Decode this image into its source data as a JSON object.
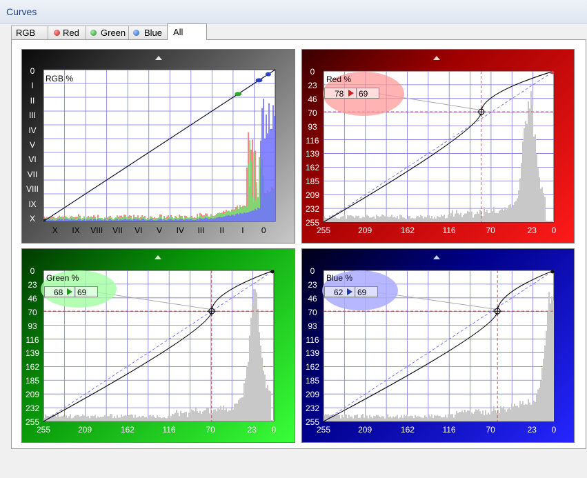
{
  "window": {
    "title": "Curves"
  },
  "tabs": [
    {
      "label": "RGB",
      "dot": ""
    },
    {
      "label": "Red",
      "dot": "#d03030"
    },
    {
      "label": "Green",
      "dot": "#30a030"
    },
    {
      "label": "Blue",
      "dot": "#2f6fd0"
    },
    {
      "label": "All",
      "dot": ""
    }
  ],
  "active_tab": "All",
  "panels": {
    "rgb": {
      "graph_label": "RGB %",
      "zone_labels_left": [
        "0",
        "I",
        "II",
        "III",
        "IV",
        "V",
        "VI",
        "VII",
        "VIII",
        "IX",
        "X"
      ],
      "zone_labels_bottom": [
        "X",
        "IX",
        "VIII",
        "VII",
        "VI",
        "V",
        "IV",
        "III",
        "II",
        "I",
        "0"
      ],
      "curve_handle_colors": [
        "#2ea82e",
        "#2b43c2"
      ]
    },
    "red": {
      "graph_label": "Red %",
      "value_in": "78",
      "value_out": "69",
      "left_scale": [
        "0",
        "23",
        "46",
        "70",
        "93",
        "116",
        "139",
        "162",
        "185",
        "209",
        "232",
        "255"
      ],
      "bottom_scale": [
        "255",
        "209",
        "162",
        "116",
        "70",
        "23",
        "0"
      ],
      "accent": "#cc2222"
    },
    "green": {
      "graph_label": "Green %",
      "value_in": "68",
      "value_out": "69",
      "left_scale": [
        "0",
        "23",
        "46",
        "70",
        "93",
        "116",
        "139",
        "162",
        "185",
        "209",
        "232",
        "255"
      ],
      "bottom_scale": [
        "255",
        "209",
        "162",
        "116",
        "70",
        "23",
        "0"
      ],
      "accent": "#1f9a1f"
    },
    "blue": {
      "graph_label": "Blue %",
      "value_in": "62",
      "value_out": "69",
      "left_scale": [
        "0",
        "23",
        "46",
        "70",
        "93",
        "116",
        "139",
        "162",
        "185",
        "209",
        "232",
        "255"
      ],
      "bottom_scale": [
        "255",
        "209",
        "162",
        "116",
        "70",
        "23",
        "0"
      ],
      "accent": "#1f37a8"
    }
  },
  "icons": {
    "collapse": "up-triangle-icon",
    "curve_point": "crosshair-point-icon"
  }
}
